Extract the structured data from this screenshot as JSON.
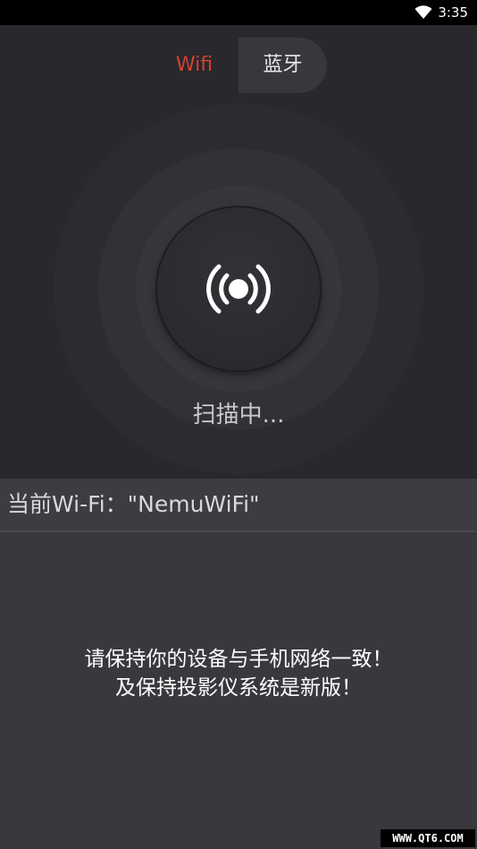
{
  "status_bar": {
    "time": "3:35",
    "wifi_icon": "wifi-signal-icon"
  },
  "tabs": [
    {
      "label": "Wifi",
      "active": true
    },
    {
      "label": "蓝牙",
      "active": false
    }
  ],
  "scan": {
    "icon": "broadcast-icon",
    "status_text": "扫描中..."
  },
  "current_wifi": {
    "label": "当前Wi-Fi：\"NemuWiFi\""
  },
  "hint": {
    "line1": "请保持你的设备与手机网络一致！",
    "line2": "及保持投影仪系统是新版！"
  },
  "watermark": "WWW.QT6.COM",
  "colors": {
    "accent": "#d4412e",
    "background": "#2b2a2e",
    "panel": "#3d3c41"
  }
}
